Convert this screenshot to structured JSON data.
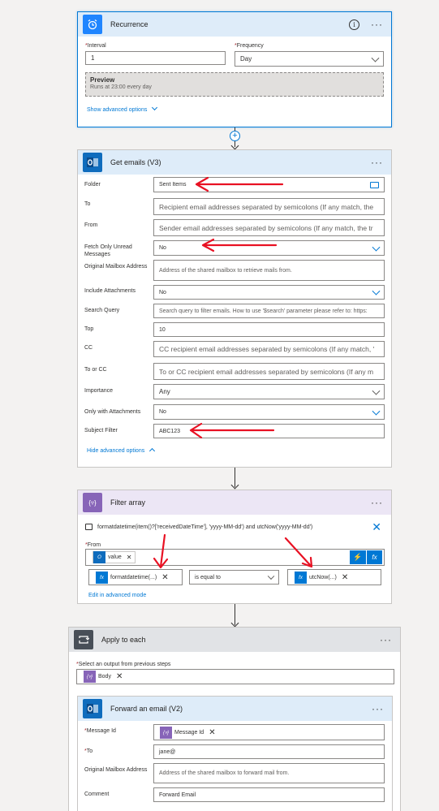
{
  "recurrence": {
    "title": "Recurrence",
    "interval_label": "Interval",
    "interval_value": "1",
    "frequency_label": "Frequency",
    "frequency_value": "Day",
    "preview_title": "Preview",
    "preview_text": "Runs at 23:00 every day",
    "advanced_link": "Show advanced options"
  },
  "get_emails": {
    "title": "Get emails (V3)",
    "fields": [
      {
        "label": "Folder",
        "value": "Sent Items"
      },
      {
        "label": "To",
        "value": "Recipient email addresses separated by semicolons (If any match, the"
      },
      {
        "label": "From",
        "value": "Sender email addresses separated by semicolons (If any match, the tr"
      },
      {
        "label": "Fetch Only Unread Messages",
        "value": "No"
      },
      {
        "label": "Original Mailbox Address",
        "value": "Address of the shared mailbox to retrieve mails from."
      },
      {
        "label": "Include Attachments",
        "value": "No"
      },
      {
        "label": "Search Query",
        "value": "Search query to filter emails. How to use '$search' parameter please refer to: https:"
      },
      {
        "label": "Top",
        "value": "10"
      },
      {
        "label": "CC",
        "value": "CC recipient email addresses separated by semicolons (If any match, '"
      },
      {
        "label": "To or CC",
        "value": "To or CC recipient email addresses separated by semicolons (If any m"
      },
      {
        "label": "Importance",
        "value": "Any"
      },
      {
        "label": "Only with Attachments",
        "value": "No"
      },
      {
        "label": "Subject Filter",
        "value": "ABC123"
      }
    ],
    "hide_link": "Hide advanced options"
  },
  "filter_array": {
    "title": "Filter array",
    "expression": "formatdatetime(item()?['receivedDateTime'], 'yyyy-MM-dd') and utcNow('yyyy-MM-dd')",
    "from_label": "From",
    "from_token": "value",
    "left_token": "formatdatetime(...)",
    "operator": "is equal to",
    "right_token": "utcNow(...)",
    "edit_link": "Edit in advanced mode"
  },
  "apply_each": {
    "title": "Apply to each",
    "select_label": "Select an output from previous steps",
    "select_token": "Body"
  },
  "forward": {
    "title": "Forward an email (V2)",
    "message_id_label": "Message Id",
    "message_id_token": "Message Id",
    "to_label": "To",
    "to_value": "jane@",
    "mailbox_label": "Original Mailbox Address",
    "mailbox_value": "Address of the shared mailbox to forward mail from.",
    "comment_label": "Comment",
    "comment_value": "Forward Email"
  },
  "colors": {
    "blue": "#0078d4",
    "purple": "#8764b8",
    "slate": "#484f58",
    "red_arrow": "#e81123"
  }
}
